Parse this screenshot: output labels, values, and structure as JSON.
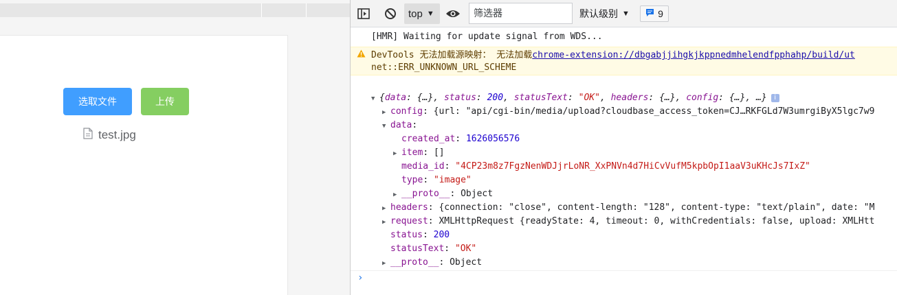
{
  "page": {
    "select_label": "选取文件",
    "upload_label": "上传",
    "file_name": "test.jpg"
  },
  "toolbar": {
    "context": "top",
    "filter_placeholder": "筛选器",
    "level": "默认级别",
    "badge_count": "9"
  },
  "console": {
    "hmr": "[HMR] Waiting for update signal from WDS...",
    "warning_prefix": "DevTools 无法加载源映射： 无法加载",
    "warning_link": "chrome-extension://dbgabjjihgkjkppnedmhelendfpphahp/build/ut",
    "warning_error": "net::ERR_UNKNOWN_URL_SCHEME",
    "summary": {
      "open": "{",
      "k_data": "data",
      "v_data": "{…}",
      "k_status": "status",
      "v_status": "200",
      "k_statusText": "statusText",
      "v_statusText": "\"OK\"",
      "k_headers": "headers",
      "v_headers": "{…}",
      "k_config": "config",
      "v_config": "{…}",
      "close": "…}"
    },
    "config_key": "config",
    "config_value": "{url: \"api/cgi-bin/media/upload?cloudbase_access_token=CJ…RKFGLd7W3umrgiByX5lgc7w9",
    "data_key": "data",
    "created_at_key": "created_at",
    "created_at_value": "1626056576",
    "item_key": "item",
    "item_value": "[]",
    "media_id_key": "media_id",
    "media_id_value": "\"4CP23m8z7FgzNenWDJjrLoNR_XxPNVn4d7HiCvVufM5kpbOpI1aaV3uKHcJs7IxZ\"",
    "type_key": "type",
    "type_value": "\"image\"",
    "proto_key": "__proto__",
    "proto_value": "Object",
    "headers_key": "headers",
    "headers_value": "{connection: \"close\", content-length: \"128\", content-type: \"text/plain\", date: \"M",
    "request_key": "request",
    "request_value": "XMLHttpRequest {readyState: 4, timeout: 0, withCredentials: false, upload: XMLHtt",
    "status_key": "status",
    "status_value": "200",
    "statusText_key": "statusText",
    "statusText_value": "\"OK\"",
    "proto2_key": "__proto__",
    "proto2_value": "Object"
  },
  "colors": {
    "primary": "#409eff",
    "success": "#85ce61",
    "devtools_key": "#881391",
    "devtools_string": "#c41a16",
    "devtools_number": "#1c00cf"
  },
  "icons": {
    "sidebar_toggle": "sidebar-toggle-icon",
    "clear": "block-icon",
    "eye": "eye-icon",
    "messages": "message-icon",
    "warning": "warning-icon",
    "file": "document-icon",
    "info": "info-icon"
  }
}
